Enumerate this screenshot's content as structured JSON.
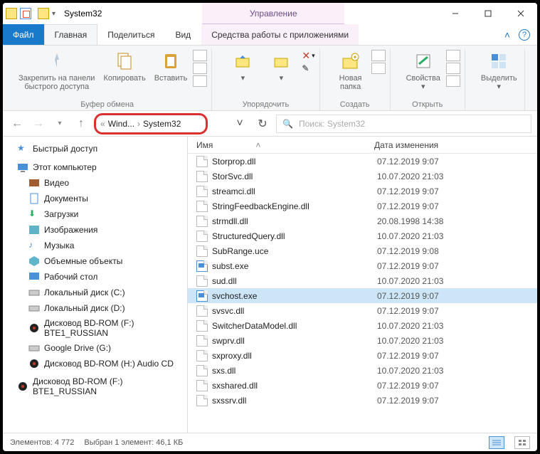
{
  "title": "System32",
  "context_tab": "Управление",
  "menu": {
    "file": "Файл",
    "home": "Главная",
    "share": "Поделиться",
    "view": "Вид",
    "apptools": "Средства работы с приложениями"
  },
  "ribbon": {
    "pin": "Закрепить на панели\nбыстрого доступа",
    "copy": "Копировать",
    "paste": "Вставить",
    "clipboard": "Буфер обмена",
    "organize": "Упорядочить",
    "newfolder": "Новая\nпапка",
    "create": "Создать",
    "properties": "Свойства",
    "open": "Открыть",
    "select": "Выделить"
  },
  "address": {
    "seg1": "Wind...",
    "seg2": "System32"
  },
  "search_placeholder": "Поиск: System32",
  "columns": {
    "name": "Имя",
    "modified": "Дата изменения"
  },
  "nav": {
    "quick": "Быстрый доступ",
    "thispc": "Этот компьютер",
    "video": "Видео",
    "docs": "Документы",
    "downloads": "Загрузки",
    "pictures": "Изображения",
    "music": "Музыка",
    "objects3d": "Объемные объекты",
    "desktop": "Рабочий стол",
    "cdrive": "Локальный диск (C:)",
    "ddrive": "Локальный диск (D:)",
    "bd_f": "Дисковод BD-ROM (F:) BTE1_RUSSIAN",
    "gdrive": "Google Drive (G:)",
    "bd_h": "Дисковод BD-ROM (H:) Audio CD",
    "bd_f2": "Дисковод BD-ROM (F:) BTE1_RUSSIAN"
  },
  "files": [
    {
      "n": "Storprop.dll",
      "d": "07.12.2019 9:07",
      "t": "dll"
    },
    {
      "n": "StorSvc.dll",
      "d": "10.07.2020 21:03",
      "t": "dll"
    },
    {
      "n": "streamci.dll",
      "d": "07.12.2019 9:07",
      "t": "dll"
    },
    {
      "n": "StringFeedbackEngine.dll",
      "d": "07.12.2019 9:07",
      "t": "dll"
    },
    {
      "n": "strmdll.dll",
      "d": "20.08.1998 14:38",
      "t": "dll"
    },
    {
      "n": "StructuredQuery.dll",
      "d": "10.07.2020 21:03",
      "t": "dll"
    },
    {
      "n": "SubRange.uce",
      "d": "07.12.2019 9:08",
      "t": "uce"
    },
    {
      "n": "subst.exe",
      "d": "07.12.2019 9:07",
      "t": "exe"
    },
    {
      "n": "sud.dll",
      "d": "10.07.2020 21:03",
      "t": "dll"
    },
    {
      "n": "svchost.exe",
      "d": "07.12.2019 9:07",
      "t": "exe",
      "sel": true
    },
    {
      "n": "svsvc.dll",
      "d": "07.12.2019 9:07",
      "t": "dll"
    },
    {
      "n": "SwitcherDataModel.dll",
      "d": "10.07.2020 21:03",
      "t": "dll"
    },
    {
      "n": "swprv.dll",
      "d": "10.07.2020 21:03",
      "t": "dll"
    },
    {
      "n": "sxproxy.dll",
      "d": "07.12.2019 9:07",
      "t": "dll"
    },
    {
      "n": "sxs.dll",
      "d": "10.07.2020 21:03",
      "t": "dll"
    },
    {
      "n": "sxshared.dll",
      "d": "07.12.2019 9:07",
      "t": "dll"
    },
    {
      "n": "sxssrv.dll",
      "d": "07.12.2019 9:07",
      "t": "dll"
    }
  ],
  "status": {
    "count_lbl": "Элементов:",
    "count": "4 772",
    "sel_lbl": "Выбран 1 элемент: 46,1 КБ"
  }
}
